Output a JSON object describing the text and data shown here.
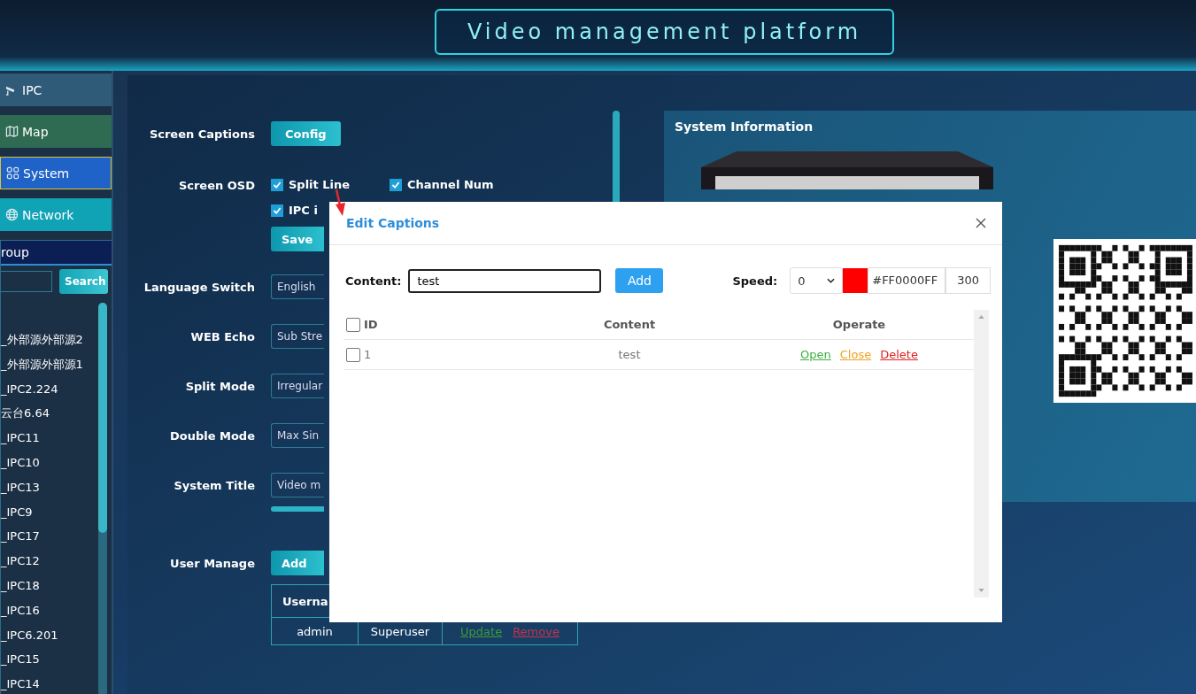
{
  "header": {
    "title": "Video management platform"
  },
  "sidebar": {
    "nav": [
      {
        "label": "IPC",
        "color": "#2f5a78",
        "selected": false
      },
      {
        "label": "Map",
        "color": "#2e6b52",
        "selected": false
      },
      {
        "label": "System",
        "color": "#1f63c9",
        "selected": true
      },
      {
        "label": "Network",
        "color": "#0fa3b5",
        "selected": false
      }
    ],
    "group": {
      "title": "roup",
      "search_button": "Search"
    },
    "tree": [
      "_外部源外部源2",
      "_外部源外部源1",
      "_IPC2.224",
      "云台6.64",
      "_IPC11",
      "_IPC10",
      "_IPC13",
      "_IPC9",
      "_IPC17",
      "_IPC12",
      "_IPC18",
      "_IPC16",
      "_IPC6.201",
      "_IPC15",
      "_IPC14"
    ]
  },
  "settings": {
    "screen_captions": {
      "label": "Screen Captions",
      "button": "Config"
    },
    "screen_osd": {
      "label": "Screen OSD",
      "options": [
        {
          "label": "Split Line",
          "checked": true
        },
        {
          "label": "Channel Num",
          "checked": true
        },
        {
          "label": "IPC i",
          "checked": true
        }
      ],
      "button": "Save"
    },
    "fields": [
      {
        "label": "Language Switch",
        "value": "English"
      },
      {
        "label": "WEB Echo",
        "value": "Sub Stre"
      },
      {
        "label": "Split Mode",
        "value": "Irregular"
      },
      {
        "label": "Double Mode",
        "value": "Max Sin"
      },
      {
        "label": "System Title",
        "value": "Video m"
      }
    ],
    "user_manage": {
      "label": "User Manage",
      "button": "Add",
      "column": "Userna",
      "rows": [
        {
          "username": "admin",
          "role": "Superuser",
          "actions": [
            {
              "label": "Update",
              "kind": "update"
            },
            {
              "label": "Remove",
              "kind": "remove"
            }
          ]
        }
      ]
    }
  },
  "system_info": {
    "title": "System Information"
  },
  "modal": {
    "title": "Edit Captions",
    "content_label": "Content:",
    "content_value": "test",
    "add_button": "Add",
    "speed_label": "Speed:",
    "speed_value": "0",
    "color": "#ff0000",
    "color_value": "#FF0000FF",
    "number_value": "300",
    "table": {
      "all_checked": false,
      "columns": [
        "ID",
        "Content",
        "Operate"
      ],
      "rows": [
        {
          "checked": false,
          "id": "1",
          "content": "test",
          "actions": [
            {
              "label": "Open",
              "kind": "open"
            },
            {
              "label": "Close",
              "kind": "close"
            },
            {
              "label": "Delete",
              "kind": "delete"
            }
          ]
        }
      ]
    }
  }
}
